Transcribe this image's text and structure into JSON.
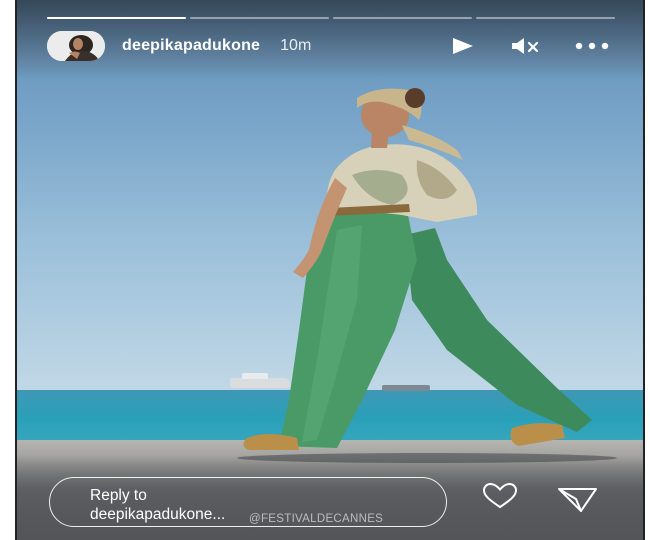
{
  "story": {
    "progress": [
      1,
      0,
      0,
      0
    ],
    "username": "deepikapadukone",
    "time": "10m",
    "icons": {
      "play": "play-icon",
      "mute": "mute-icon",
      "more": "more-horizontal-icon"
    }
  },
  "footer": {
    "reply_line1": "Reply to",
    "reply_line2": "deepikapadukone...",
    "like_icon": "heart-icon",
    "send_icon": "send-icon"
  },
  "photo": {
    "watermark": "@FESTIVALDECANNES"
  }
}
